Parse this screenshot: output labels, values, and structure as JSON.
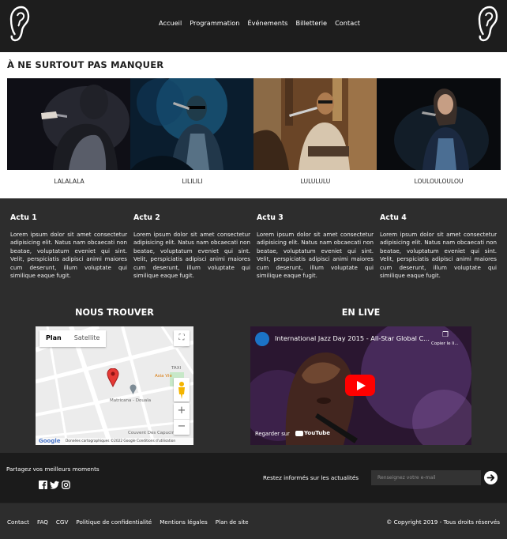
{
  "nav": {
    "items": [
      "Accueil",
      "Programmation",
      "Événements",
      "Billetterie",
      "Contact"
    ]
  },
  "featured": {
    "title": "À NE SURTOUT PAS MANQUER",
    "artists": [
      "LALALALA",
      "LILILILI",
      "LULULULU",
      "LOULOULOULOU"
    ]
  },
  "news": [
    {
      "title": "Actu 1",
      "body": "Lorem ipsum dolor sit amet consectetur adipisicing elit. Natus nam obcaecati non beatae, voluptatum eveniet qui sint. Velit, perspiciatis adipisci animi maiores cum deserunt, illum voluptate qui similique eaque fugit."
    },
    {
      "title": "Actu 2",
      "body": "Lorem ipsum dolor sit amet consectetur adipisicing elit. Natus nam obcaecati non beatae, voluptatum eveniet qui sint. Velit, perspiciatis adipisci animi maiores cum deserunt, illum voluptate qui similique eaque fugit."
    },
    {
      "title": "Actu 3",
      "body": "Lorem ipsum dolor sit amet consectetur adipisicing elit. Natus nam obcaecati non beatae, voluptatum eveniet qui sint. Velit, perspiciatis adipisci animi maiores cum deserunt, illum voluptate qui similique eaque fugit."
    },
    {
      "title": "Actu 4",
      "body": "Lorem ipsum dolor sit amet consectetur adipisicing elit. Natus nam obcaecati non beatae, voluptatum eveniet qui sint. Velit, perspiciatis adipisci animi maiores cum deserunt, illum voluptate qui similique eaque fugit."
    }
  ],
  "find": {
    "title": "NOUS TROUVER",
    "map_tabs": [
      "Plan",
      "Satellite"
    ],
    "labels": [
      "Matricana - Douala",
      "Couvent Des Capucins",
      "Asia Vie",
      "TAXI"
    ],
    "attribution": "Données cartographiques ©2022 Google   Conditions d'utilisation",
    "provider": "Google",
    "zoom_in": "+",
    "zoom_out": "−"
  },
  "live": {
    "title": "EN LIVE",
    "video_title": "International Jazz Day 2015 - All-Star Global C...",
    "copy_link": "Copier le li...",
    "watch_on": "Regarder sur",
    "provider": "YouTube"
  },
  "footer": {
    "share": "Partagez vos meilleurs moments",
    "newsletter": "Restez informés sur les actualités",
    "email_placeholder": "Renseignez votre e-mail",
    "links": [
      "Contact",
      "FAQ",
      "CGV",
      "Politique de confidentialité",
      "Mentions légales",
      "Plan de site"
    ],
    "copyright": "© Copyright 2019 - Tous droits réservés"
  },
  "colors": {
    "header": "#1d1d1d",
    "background": "#2d2d2d",
    "youtube_red": "#ff0000",
    "map_pin": "#e53935"
  },
  "icons": [
    "ear-logo-icon",
    "facebook-icon",
    "twitter-icon",
    "instagram-icon",
    "arrow-right-icon",
    "fullscreen-icon",
    "pegman-icon",
    "map-pin-icon",
    "copy-icon",
    "play-icon"
  ]
}
